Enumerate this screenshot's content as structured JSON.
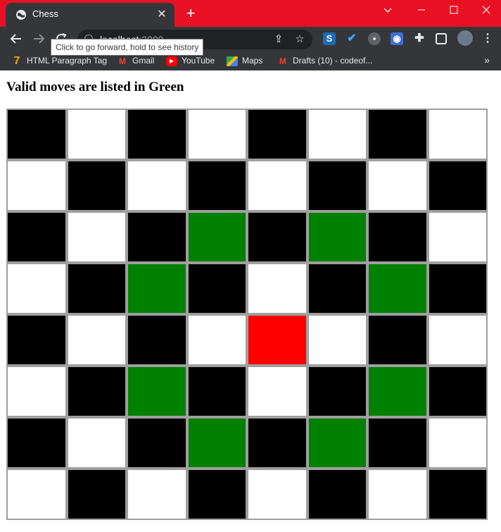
{
  "browser": {
    "tab_title": "Chess",
    "tab_close": "✕",
    "new_tab": "+",
    "omnibox_host": "localhost",
    "omnibox_port": ":3000",
    "tooltip": "Click to go forward, hold to see history",
    "bookmarks": [
      {
        "label": "HTML Paragraph Tag",
        "icon": "seven-icon"
      },
      {
        "label": "Gmail",
        "icon": "gmail-icon"
      },
      {
        "label": "YouTube",
        "icon": "youtube-icon"
      },
      {
        "label": "Maps",
        "icon": "maps-icon"
      },
      {
        "label": "Drafts (10) - codeof...",
        "icon": "gmail-icon"
      }
    ],
    "bookmarks_more": "»",
    "accent_color": "#e81123"
  },
  "page": {
    "title": "Valid moves are listed in Green"
  },
  "board": {
    "rows": 8,
    "cols": 8,
    "colors": {
      "dark": "#000000",
      "light": "#ffffff",
      "valid": "#008000",
      "selected": "#ff0000"
    },
    "selected": [
      4,
      4
    ],
    "valid_moves": [
      [
        2,
        3
      ],
      [
        2,
        5
      ],
      [
        3,
        2
      ],
      [
        3,
        6
      ],
      [
        5,
        2
      ],
      [
        5,
        6
      ],
      [
        6,
        3
      ],
      [
        6,
        5
      ]
    ]
  }
}
